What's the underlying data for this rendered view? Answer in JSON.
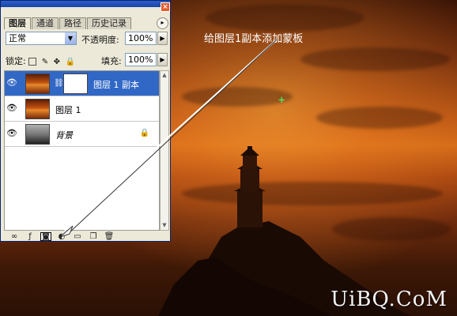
{
  "tabs": [
    "图层",
    "通道",
    "路径",
    "历史记录"
  ],
  "blend_mode": "正常",
  "opacity_label": "不透明度:",
  "opacity_value": "100%",
  "lock_label": "锁定:",
  "fill_label": "填充:",
  "fill_value": "100%",
  "layers": [
    {
      "name": "图层 1 副本",
      "selected": true,
      "has_mask": true
    },
    {
      "name": "图层 1",
      "selected": false,
      "has_mask": false
    },
    {
      "name": "背景",
      "selected": false,
      "locked": true
    }
  ],
  "caption": "给图层1副本添加蒙板",
  "watermark": "UiBQ.CoM",
  "icons": [
    "link-layers-icon",
    "layer-style-icon",
    "add-mask-icon",
    "adjustment-layer-icon",
    "new-group-icon",
    "new-layer-icon",
    "delete-layer-icon"
  ]
}
